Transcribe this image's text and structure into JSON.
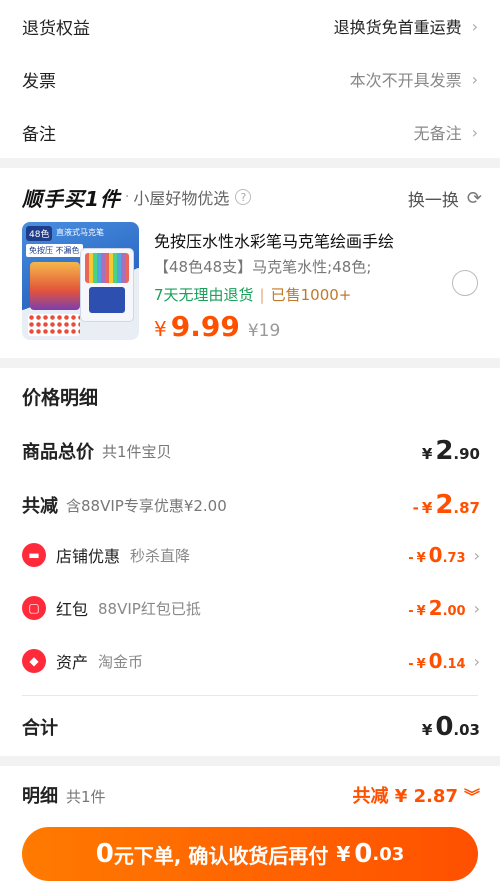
{
  "rows": [
    {
      "label": "退货权益",
      "value": "退换货免首重运费",
      "dark": true
    },
    {
      "label": "发票",
      "value": "本次不开具发票",
      "dark": false
    },
    {
      "label": "备注",
      "value": "无备注",
      "dark": false
    }
  ],
  "addon": {
    "brand": "顺手买1件",
    "subtitle": "小屋好物优选",
    "swap_label": "换一换",
    "product": {
      "image_tag": "48色",
      "image_text": "直液式马克笔",
      "image_tag2": "免按压 不漏色",
      "title": "免按压水性水彩笔马克笔绘画手绘",
      "spec": "【48色48支】马克笔水性;48色;",
      "return_tag": "7天无理由退货",
      "sold": "已售1000+",
      "price_symbol": "¥",
      "price": "9.99",
      "original_price": "¥19"
    }
  },
  "price_detail": {
    "title": "价格明细",
    "total": {
      "label": "商品总价",
      "sub": "共1件宝贝",
      "yen": "¥",
      "int": "2",
      "dec": ".90"
    },
    "reduce": {
      "label": "共减",
      "sub": "含88VIP专享优惠¥2.00",
      "minus": "-",
      "yen": "¥",
      "int": "2",
      "dec": ".87"
    },
    "discounts": [
      {
        "icon": "shop-icon",
        "icon_char": "▬",
        "label": "店铺优惠",
        "sub": "秒杀直降",
        "minus": "-",
        "yen": "¥",
        "int": "0",
        "dec": ".73"
      },
      {
        "icon": "red-packet-icon",
        "icon_char": "▢",
        "label": "红包",
        "sub": "88VIP红包已抵",
        "minus": "-",
        "yen": "¥",
        "int": "2",
        "dec": ".00"
      },
      {
        "icon": "coin-tag-icon",
        "icon_char": "◆",
        "label": "资产",
        "sub": "淘金币",
        "minus": "-",
        "yen": "¥",
        "int": "0",
        "dec": ".14"
      }
    ],
    "sum": {
      "label": "合计",
      "yen": "¥",
      "int": "0",
      "dec": ".03"
    }
  },
  "footer": {
    "label": "明细",
    "sub": "共1件",
    "reduce_text": "共减 ¥ 2.87",
    "submit_zero": "0",
    "submit_text": "元下单, 确认收货后再付",
    "submit_yen": "¥",
    "submit_int": "0",
    "submit_dec": ".03"
  },
  "colors": {
    "accent": "#ff5000",
    "green": "#1aa05a",
    "red_icon": "#ff2a3a"
  }
}
